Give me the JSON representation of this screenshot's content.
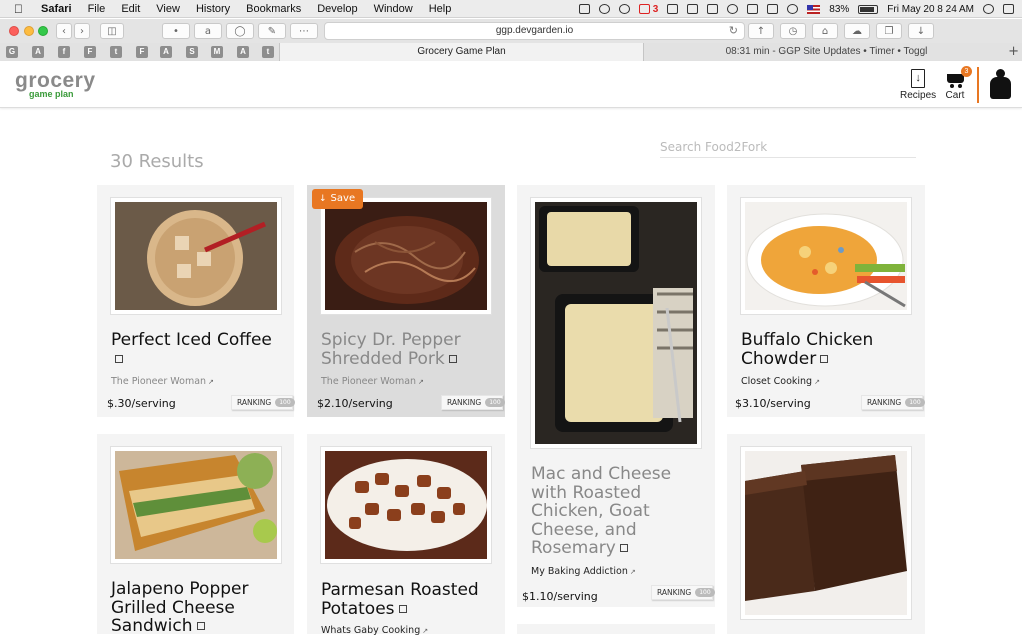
{
  "menubar": {
    "app": "Safari",
    "items": [
      "File",
      "Edit",
      "View",
      "History",
      "Bookmarks",
      "Develop",
      "Window",
      "Help"
    ],
    "mail_count": "3",
    "battery": "83%",
    "datetime": "Fri May 20  8 24 AM"
  },
  "browser": {
    "url": "ggp.devgarden.io",
    "tabs": [
      {
        "label": "Grocery Game Plan"
      },
      {
        "label": "08:31 min - GGP Site Updates • Timer • Toggl"
      }
    ],
    "favorites": [
      "G",
      "A",
      "f",
      "F",
      "t",
      "F",
      "A",
      "S",
      "M",
      "A",
      "t"
    ]
  },
  "header": {
    "logo_top": "grocery",
    "logo_sub": "game plan",
    "recipes_label": "Recipes",
    "cart_label": "Cart",
    "cart_count": "3"
  },
  "results": {
    "count_label": "30 Results",
    "search_placeholder": "Search Food2Fork"
  },
  "cards": [
    {
      "title": "Perfect Iced Coffee",
      "source": "The Pioneer Woman",
      "price": "$.30/serving",
      "ranking_label": "RANKING",
      "ranking_value": "100"
    },
    {
      "title": "Spicy Dr. Pepper Shredded Pork",
      "source": "The Pioneer Woman",
      "price": "$2.10/serving",
      "ranking_label": "RANKING",
      "ranking_value": "100",
      "save_label": "Save"
    },
    {
      "title": "Mac and Cheese with Roasted Chicken, Goat Cheese, and Rosemary",
      "source": "My Baking Addiction",
      "price": "$1.10/serving",
      "ranking_label": "RANKING",
      "ranking_value": "100"
    },
    {
      "title": "Buffalo Chicken Chowder",
      "source": "Closet Cooking",
      "price": "$3.10/serving",
      "ranking_label": "RANKING",
      "ranking_value": "100"
    },
    {
      "title": "Jalapeno Popper Grilled Cheese Sandwich"
    },
    {
      "title": "Parmesan Roasted Potatoes",
      "source": "Whats Gaby Cooking"
    }
  ],
  "colors": {
    "accent": "#e87722",
    "brand_green": "#3a9b3a"
  }
}
